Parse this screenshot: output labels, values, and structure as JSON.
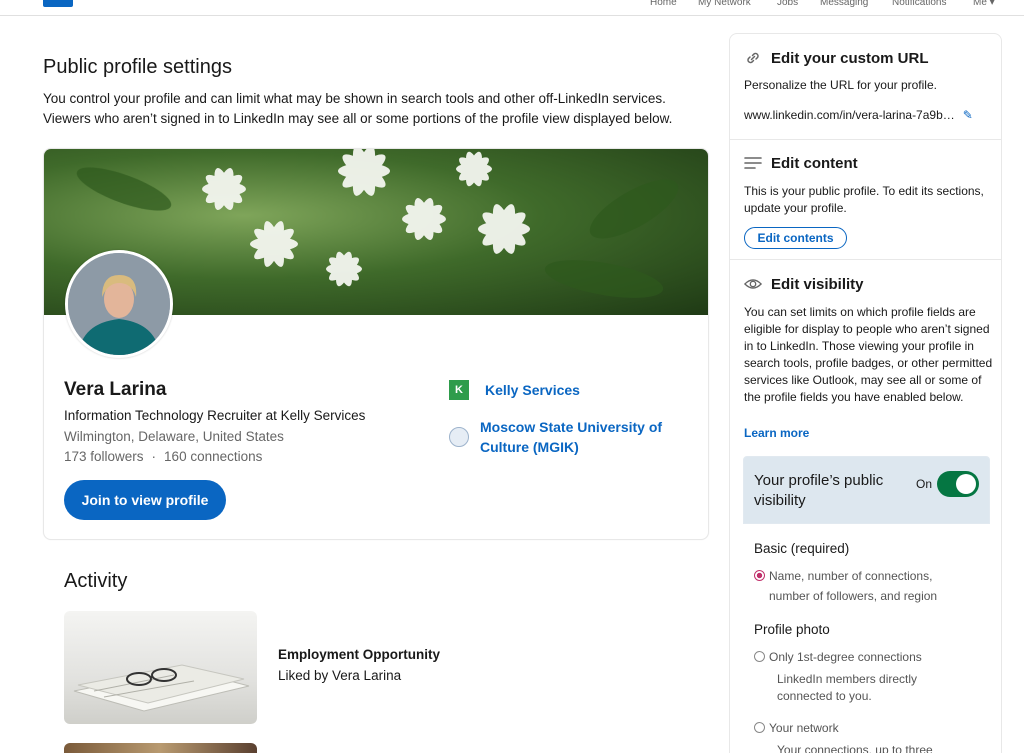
{
  "nav": {
    "home": "Home",
    "my_network": "My Network",
    "jobs": "Jobs",
    "messaging": "Messaging",
    "notifications": "Notifications",
    "me": "Me"
  },
  "page": {
    "title": "Public profile settings",
    "intro": "You control your profile and can limit what may be shown in search tools and other off-LinkedIn services. Viewers who aren’t signed in to LinkedIn may see all or some portions of the profile view displayed below."
  },
  "profile": {
    "name": "Vera Larina",
    "headline": "Information Technology Recruiter at Kelly Services",
    "location": "Wilmington, Delaware, United States",
    "followers": "173 followers",
    "connections": "160 connections",
    "dot": "·",
    "join_label": "Join to view profile",
    "company_logo_letter": "K",
    "company": "Kelly Services",
    "school": "Moscow State University of Culture (MGIK)"
  },
  "activity": {
    "title": "Activity",
    "item_title": "Employment Opportunity",
    "item_sub": "Liked by Vera Larina"
  },
  "rail": {
    "url": {
      "heading": "Edit your custom URL",
      "text": "Personalize the URL for your profile.",
      "value": "www.linkedin.com/in/vera-larina-7a9b…"
    },
    "content": {
      "heading": "Edit content",
      "text": "This is your public profile. To edit its sections, update your profile.",
      "button": "Edit contents"
    },
    "visibility": {
      "heading": "Edit visibility",
      "text": "You can set limits on which profile fields are eligible for display to people who aren’t signed in to LinkedIn. Those viewing your profile in search tools, profile badges, or other permitted services like Outlook, may see all or some of the profile fields you have enabled below.",
      "learn_more": "Learn more",
      "public_label": "Your profile’s public visibility",
      "toggle_state": "On"
    },
    "basic": {
      "heading": "Basic (required)",
      "option": "Name, number of connections, number of followers, and region"
    },
    "photo": {
      "heading": "Profile photo",
      "option1": "Only 1st-degree connections",
      "option1_desc": "LinkedIn members directly connected to you.",
      "option2": "Your network",
      "option2_desc": "Your connections, up to three"
    }
  },
  "colors": {
    "brand": "#0a66c2",
    "toggle_on": "#057642",
    "radio_selected": "#c0306b"
  }
}
